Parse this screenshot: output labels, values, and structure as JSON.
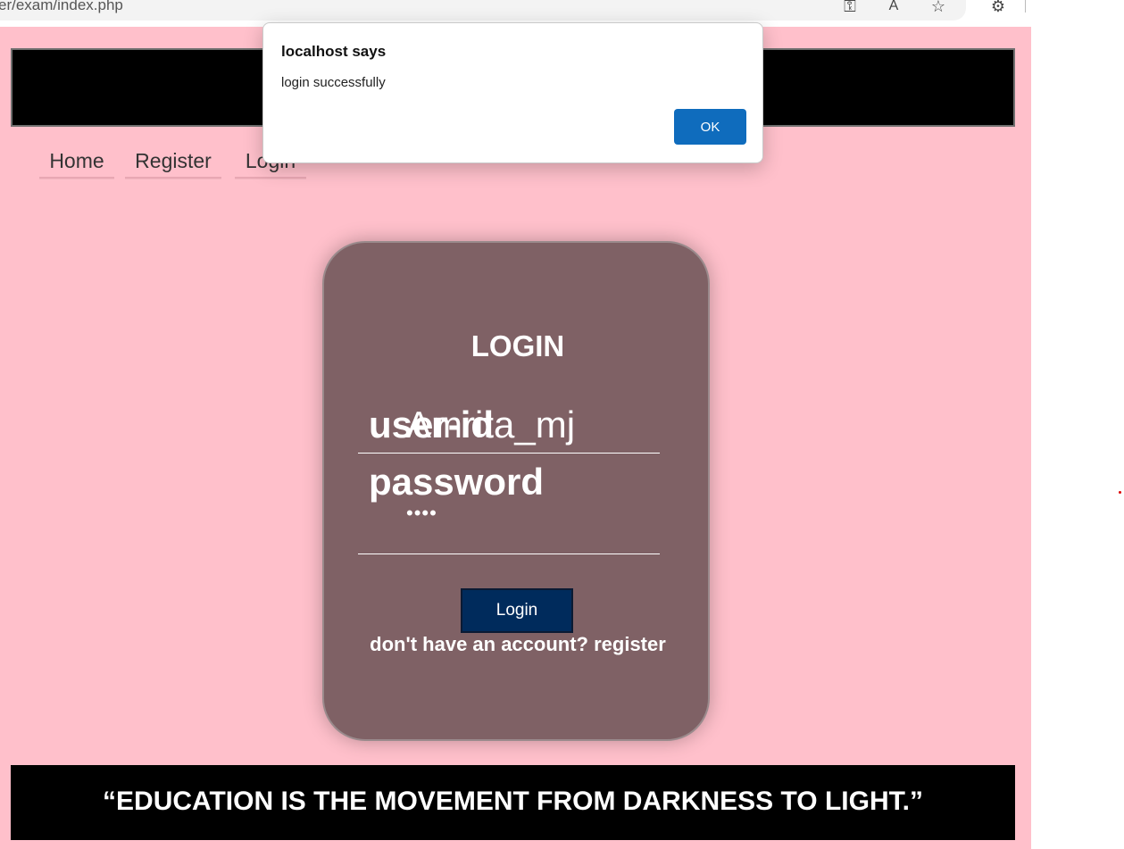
{
  "browser": {
    "url": "er/exam/index.php",
    "toolbar_icons": [
      "key-icon",
      "read-aloud-icon",
      "favorite-star-icon",
      "extensions-icon"
    ]
  },
  "nav": {
    "items": [
      {
        "label": "Home"
      },
      {
        "label": "Register"
      },
      {
        "label": "Login"
      }
    ]
  },
  "login": {
    "title": "LOGIN",
    "userid_label": "user-id",
    "userid_value": "Amrita_mj",
    "password_label": "password",
    "password_value": "••••",
    "button_label": "Login",
    "register_prompt": "don't have an account? register"
  },
  "footer": {
    "quote": "“EDUCATION IS THE MOVEMENT FROM DARKNESS TO LIGHT.”"
  },
  "dialog": {
    "title": "localhost says",
    "message": "login successfully",
    "ok_label": "OK"
  },
  "colors": {
    "page_background": "#ffc0cb",
    "card_background": "#7f6165",
    "button_background": "#002b5c",
    "dialog_ok_background": "#0f6cbd",
    "band_background": "#000000"
  }
}
